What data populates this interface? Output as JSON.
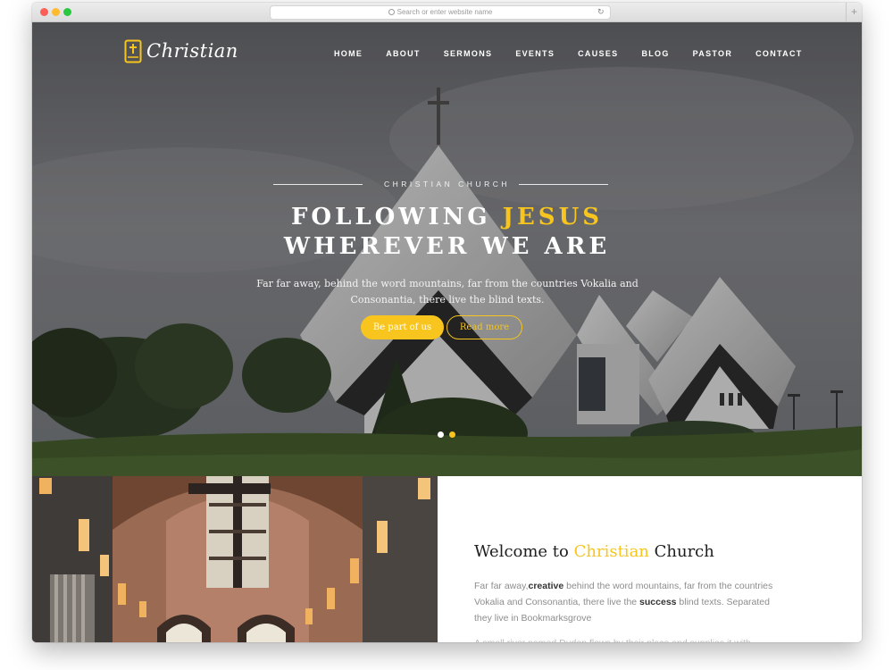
{
  "browser": {
    "address_placeholder": "Search or enter website name",
    "new_tab": "+"
  },
  "site": {
    "logo_text": "Christian",
    "nav": [
      "HOME",
      "ABOUT",
      "SERMONS",
      "EVENTS",
      "CAUSES",
      "BLOG",
      "PASTOR",
      "CONTACT"
    ]
  },
  "hero": {
    "kicker": "CHRISTIAN CHURCH",
    "title_line1_a": "FOLLOWING ",
    "title_line1_b": "JESUS",
    "title_line2": "WHEREVER WE ARE",
    "lead": "Far far away, behind the word mountains, far from the countries Vokalia and Consonantia, there live the blind texts.",
    "primary_button": "Be part of us",
    "secondary_button": "Read more",
    "slides": 2,
    "active_slide": 2
  },
  "welcome": {
    "title_a": "Welcome to ",
    "title_b": "Christian",
    "title_c": " Church",
    "p1_a": "Far far away,",
    "p1_b": "creative",
    "p1_c": " behind the word mountains, far from the countries Vokalia and Consonantia, there live the ",
    "p1_d": "success",
    "p1_e": " blind texts. Separated they live in Bookmarksgrove",
    "p2": "A small river named Duden flows by their place and supplies it with"
  },
  "colors": {
    "accent": "#f7c51e",
    "heading": "#1e1e1e",
    "body_text": "#8d8d8d"
  }
}
